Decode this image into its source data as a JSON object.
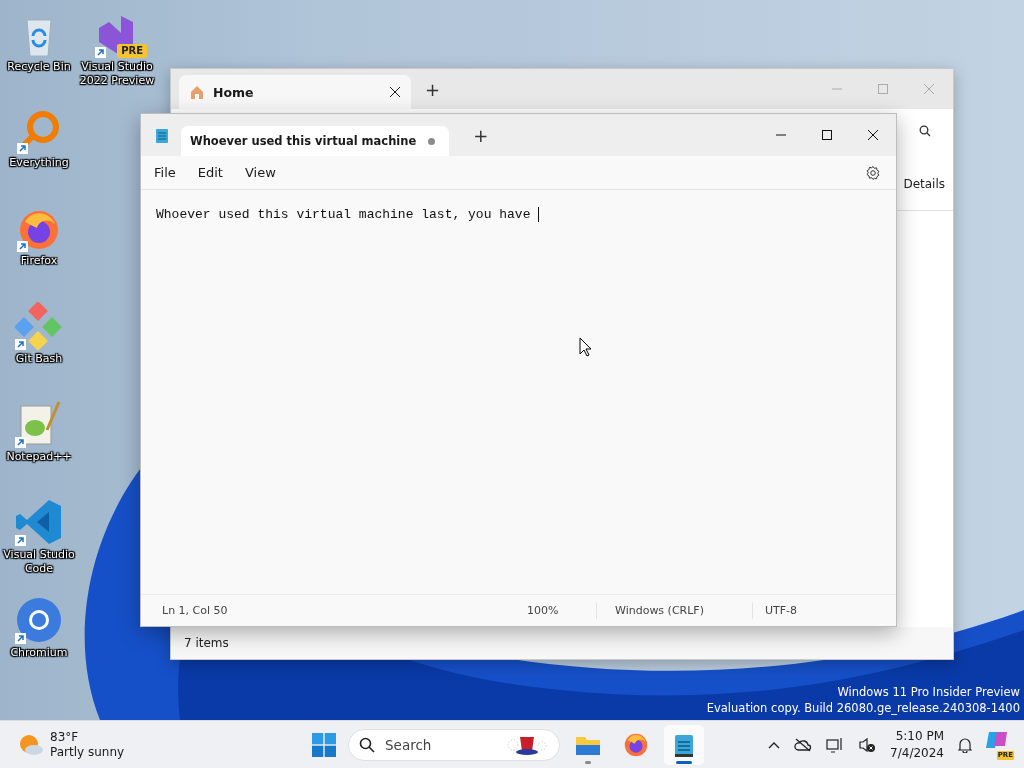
{
  "desktop_icons": [
    {
      "label": "Recycle Bin",
      "kind": "recycle-bin",
      "shortcut": false
    },
    {
      "label": "Visual Studio 2022 Preview",
      "kind": "vs-preview",
      "shortcut": true,
      "badge": "PRE"
    },
    {
      "label": "Everything",
      "kind": "everything",
      "shortcut": true
    },
    {
      "label": "Firefox",
      "kind": "firefox",
      "shortcut": true
    },
    {
      "label": "Git Bash",
      "kind": "git",
      "shortcut": true
    },
    {
      "label": "Notepad++",
      "kind": "notepadpp",
      "shortcut": true
    },
    {
      "label": "Visual Studio Code",
      "kind": "vscode",
      "shortcut": true
    },
    {
      "label": "Chromium",
      "kind": "chromium",
      "shortcut": true
    }
  ],
  "explorer": {
    "tabs": [
      {
        "label": "Home",
        "selected": true
      }
    ],
    "new_tab": "+",
    "toolbar_text": "Details",
    "status": "7 items"
  },
  "notepad": {
    "tabs": [
      {
        "label": "Whoever used this virtual machine",
        "selected": true,
        "modified": true
      }
    ],
    "new_tab": "+",
    "menu": [
      "File",
      "Edit",
      "View"
    ],
    "text": "Whoever used this virtual machine last, you have ",
    "status_bar": {
      "position": "Ln 1, Col 50",
      "zoom": "100%",
      "line_ending": "Windows (CRLF)",
      "encoding": "UTF-8"
    }
  },
  "watermark": [
    "Windows 11 Pro Insider Preview",
    "Evaluation copy. Build 26080.ge_release.240308-1400"
  ],
  "taskbar": {
    "weather": {
      "temperature": "83°F",
      "condition": "Partly sunny"
    },
    "search": {
      "placeholder": "Search"
    },
    "apps": [
      {
        "kind": "file-explorer",
        "running": true,
        "selected": false
      },
      {
        "kind": "firefox",
        "running": false,
        "selected": false
      },
      {
        "kind": "notepad",
        "running": true,
        "selected": true
      }
    ],
    "clock": {
      "time": "5:10 PM",
      "date": "7/4/2024"
    },
    "copilot_badge": "PRE"
  }
}
